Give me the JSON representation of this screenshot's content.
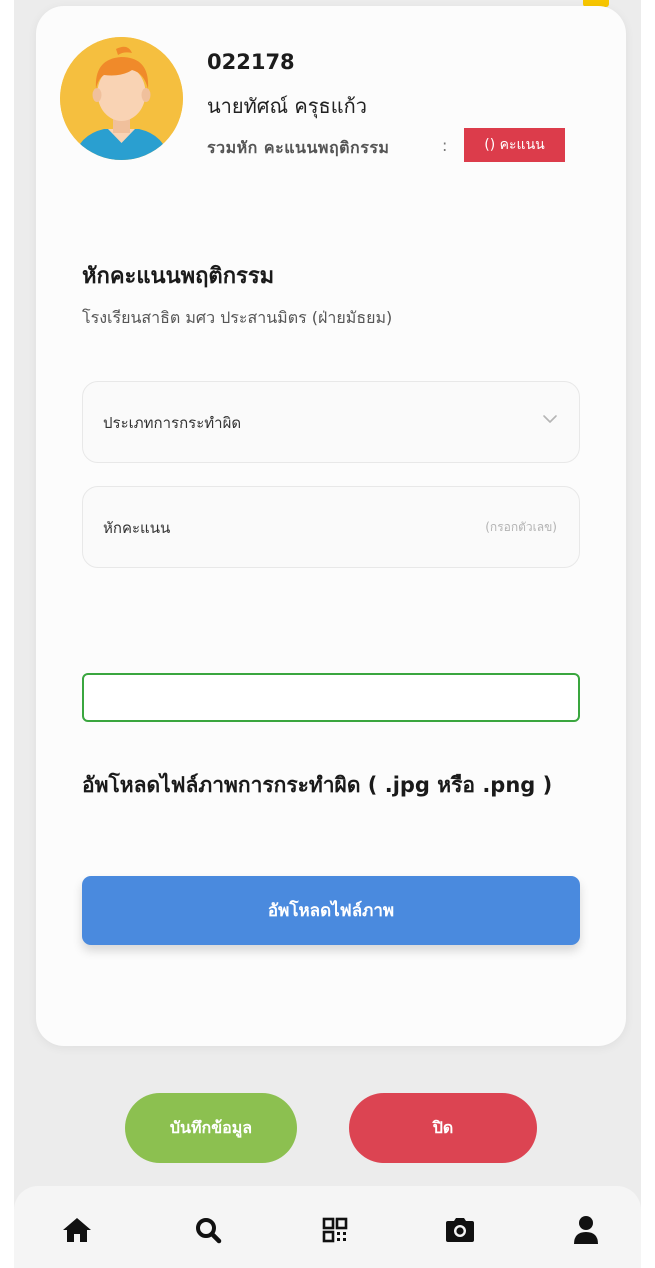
{
  "student": {
    "id": "022178",
    "name": "นายทัศณ์ ครุธแก้ว",
    "total_label": "รวมหัก คะแนนพฤติกรรม",
    "colon": ":",
    "score_badge": "() คะแนน"
  },
  "form": {
    "title": "หักคะแนนพฤติกรรม",
    "school": "โรงเรียนสาธิต มศว ประสานมิตร (ฝ่ายมัธยม)",
    "offense_type_label": "ประเภทการกระทำผิด",
    "deduct_label": "หักคะแนน",
    "deduct_hint": "(กรอกตัวเลข)",
    "note_value": "",
    "upload_title": "อัพโหลดไฟล์ภาพการกระทำผิด ( .jpg หรือ .png )",
    "upload_button": "อัพโหลดไฟล์ภาพ"
  },
  "actions": {
    "save": "บันทึกข้อมูล",
    "close": "ปิด"
  },
  "nav": {
    "items": [
      "home-icon",
      "search-icon",
      "qr-code-icon",
      "camera-icon",
      "user-icon"
    ]
  },
  "colors": {
    "badge": "#dc3c4b",
    "upload": "#4a8ade",
    "save": "#8cc050",
    "close": "#dc4452",
    "input_border": "#3aa63f",
    "accent": "#f7c600"
  }
}
